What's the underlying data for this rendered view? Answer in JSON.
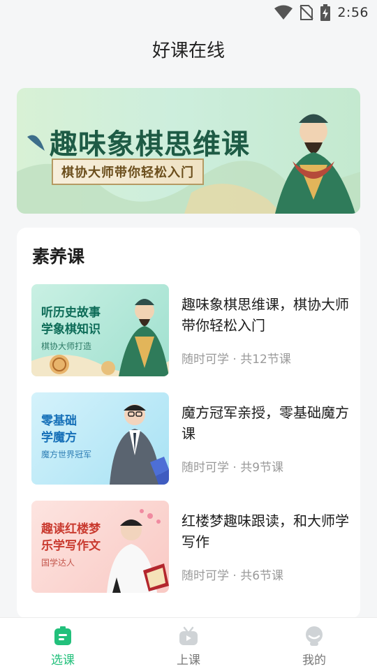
{
  "status_bar": {
    "time": "2:56"
  },
  "header": {
    "title": "好课在线"
  },
  "banner": {
    "title": "趣味象棋思维课",
    "subtitle": "棋协大师带你轻松入门"
  },
  "section": {
    "title": "素养课"
  },
  "courses": [
    {
      "thumb_line1": "听历史故事",
      "thumb_line2": "学象棋知识",
      "thumb_tag": "棋协大师打造",
      "title": "趣味象棋思维课，棋协大师带你轻松入门",
      "meta": "随时可学 · 共12节课"
    },
    {
      "thumb_line1": "零基础",
      "thumb_line2": "学魔方",
      "thumb_tag": "魔方世界冠军",
      "title": "魔方冠军亲授，零基础魔方课",
      "meta": "随时可学 · 共9节课"
    },
    {
      "thumb_line1": "趣读红楼梦",
      "thumb_line2": "乐学写作文",
      "thumb_tag": "国学达人",
      "title": "红楼梦趣味跟读，和大师学写作",
      "meta": "随时可学 · 共6节课"
    }
  ],
  "tabbar": {
    "tabs": [
      {
        "label": "选课",
        "icon": "course-select-icon",
        "active": true
      },
      {
        "label": "上课",
        "icon": "tv-icon",
        "active": false
      },
      {
        "label": "我的",
        "icon": "profile-icon",
        "active": false
      }
    ]
  },
  "colors": {
    "accent": "#22c07b",
    "banner_title": "#1e5b45"
  }
}
